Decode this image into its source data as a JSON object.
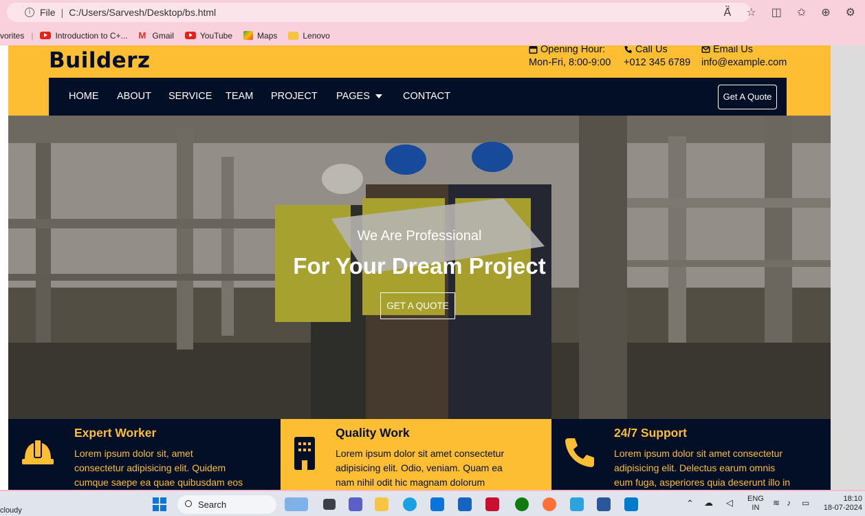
{
  "browser": {
    "info_icon": "i",
    "address_scheme": "File",
    "address_path": "C:/Users/Sarvesh/Desktop/bs.html",
    "icons": [
      "Ä́",
      "☆",
      "◫",
      "✩",
      "⊕",
      "⚙"
    ]
  },
  "favorites": [
    {
      "label": "vorites",
      "icon": "none"
    },
    {
      "label": "Introduction to C+...",
      "icon": "youtube-icon"
    },
    {
      "label": "Gmail",
      "icon": "gmail-icon"
    },
    {
      "label": "YouTube",
      "icon": "youtube-icon"
    },
    {
      "label": "Maps",
      "icon": "maps-icon"
    },
    {
      "label": "Lenovo",
      "icon": "folder-icon"
    }
  ],
  "header": {
    "logo": "Builderz",
    "opening_label": "Opening Hour:",
    "opening_value": "Mon-Fri, 8:00-9:00",
    "call_label": "Call Us",
    "call_value": "+012 345 6789",
    "email_label": "Email Us",
    "email_value": "info@example.com"
  },
  "nav": {
    "items": [
      "HOME",
      "ABOUT",
      "SERVICE",
      "TEAM",
      "PROJECT",
      "PAGES",
      "CONTACT"
    ],
    "quote_button": "Get A Quote"
  },
  "hero": {
    "subtitle": "We Are Professional",
    "title": "For Your Dream Project",
    "button": "GET A QUOTE"
  },
  "features": [
    {
      "title": "Expert Worker",
      "text": [
        "Lorem ipsum dolor sit, amet",
        "consectetur adipisicing elit. Quidem",
        "cumque saepe ea quae quibusdam eos"
      ]
    },
    {
      "title": "Quality Work",
      "text": [
        "Lorem ipsum dolor sit amet consectetur",
        "adipisicing elit. Odio, veniam. Quam ea",
        "nam nihil odit hic magnam dolorum"
      ]
    },
    {
      "title": "24/7 Support",
      "text": [
        "Lorem ipsum dolor sit amet consectetur",
        "adipisicing elit. Delectus earum omnis",
        "eum fuga, asperiores quia deserunt illo in"
      ]
    }
  ],
  "taskbar": {
    "weather": "cloudy",
    "search": "Search",
    "lang_top": "ENG",
    "lang_bottom": "IN",
    "time": "18:10",
    "date": "18-07-2024"
  },
  "colors": {
    "brand_yellow": "#fdbe33",
    "brand_navy": "#030f27",
    "browser_pink": "#f9d1dc"
  }
}
